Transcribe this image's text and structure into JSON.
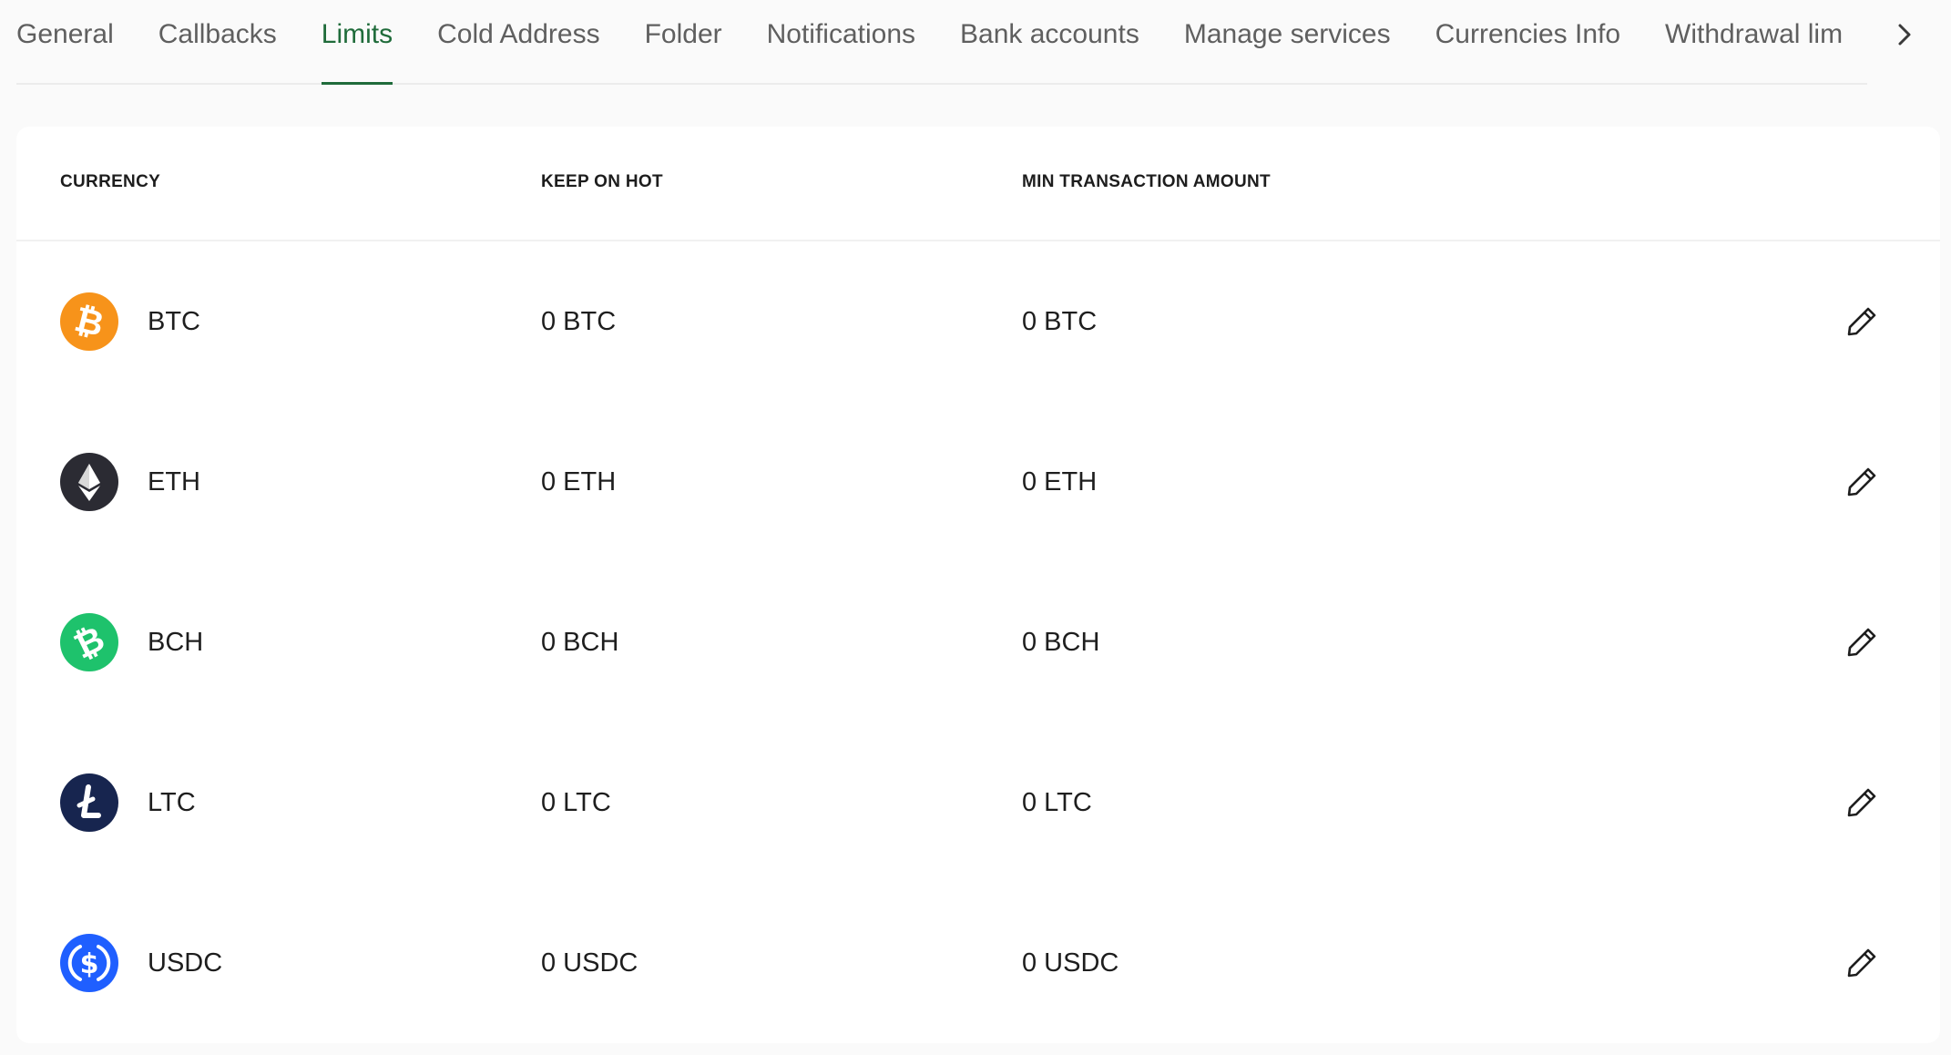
{
  "tabs": [
    {
      "label": "General"
    },
    {
      "label": "Callbacks"
    },
    {
      "label": "Limits"
    },
    {
      "label": "Cold Address"
    },
    {
      "label": "Folder"
    },
    {
      "label": "Notifications"
    },
    {
      "label": "Bank accounts"
    },
    {
      "label": "Manage services"
    },
    {
      "label": "Currencies Info"
    },
    {
      "label": "Withdrawal lim"
    }
  ],
  "active_tab": "Limits",
  "table": {
    "headers": {
      "currency": "CURRENCY",
      "keep_on_hot": "KEEP ON HOT",
      "min_transaction_amount": "MIN TRANSACTION AMOUNT"
    },
    "rows": [
      {
        "code": "BTC",
        "keep_on_hot": "0 BTC",
        "min_amount": "0 BTC",
        "icon": "bitcoin-icon",
        "color": "#f7931a"
      },
      {
        "code": "ETH",
        "keep_on_hot": "0 ETH",
        "min_amount": "0 ETH",
        "icon": "ethereum-icon",
        "color": "#2b2b33"
      },
      {
        "code": "BCH",
        "keep_on_hot": "0 BCH",
        "min_amount": "0 BCH",
        "icon": "bitcoin-cash-icon",
        "color": "#1ec26c"
      },
      {
        "code": "LTC",
        "keep_on_hot": "0 LTC",
        "min_amount": "0 LTC",
        "icon": "litecoin-icon",
        "color": "#17254f"
      },
      {
        "code": "USDC",
        "keep_on_hot": "0 USDC",
        "min_amount": "0 USDC",
        "icon": "usdc-icon",
        "color": "#1f5fff"
      }
    ]
  },
  "colors": {
    "accent": "#1f6b3a",
    "tab_text": "#5f5f5f",
    "background": "#fafafa",
    "card": "#ffffff"
  }
}
